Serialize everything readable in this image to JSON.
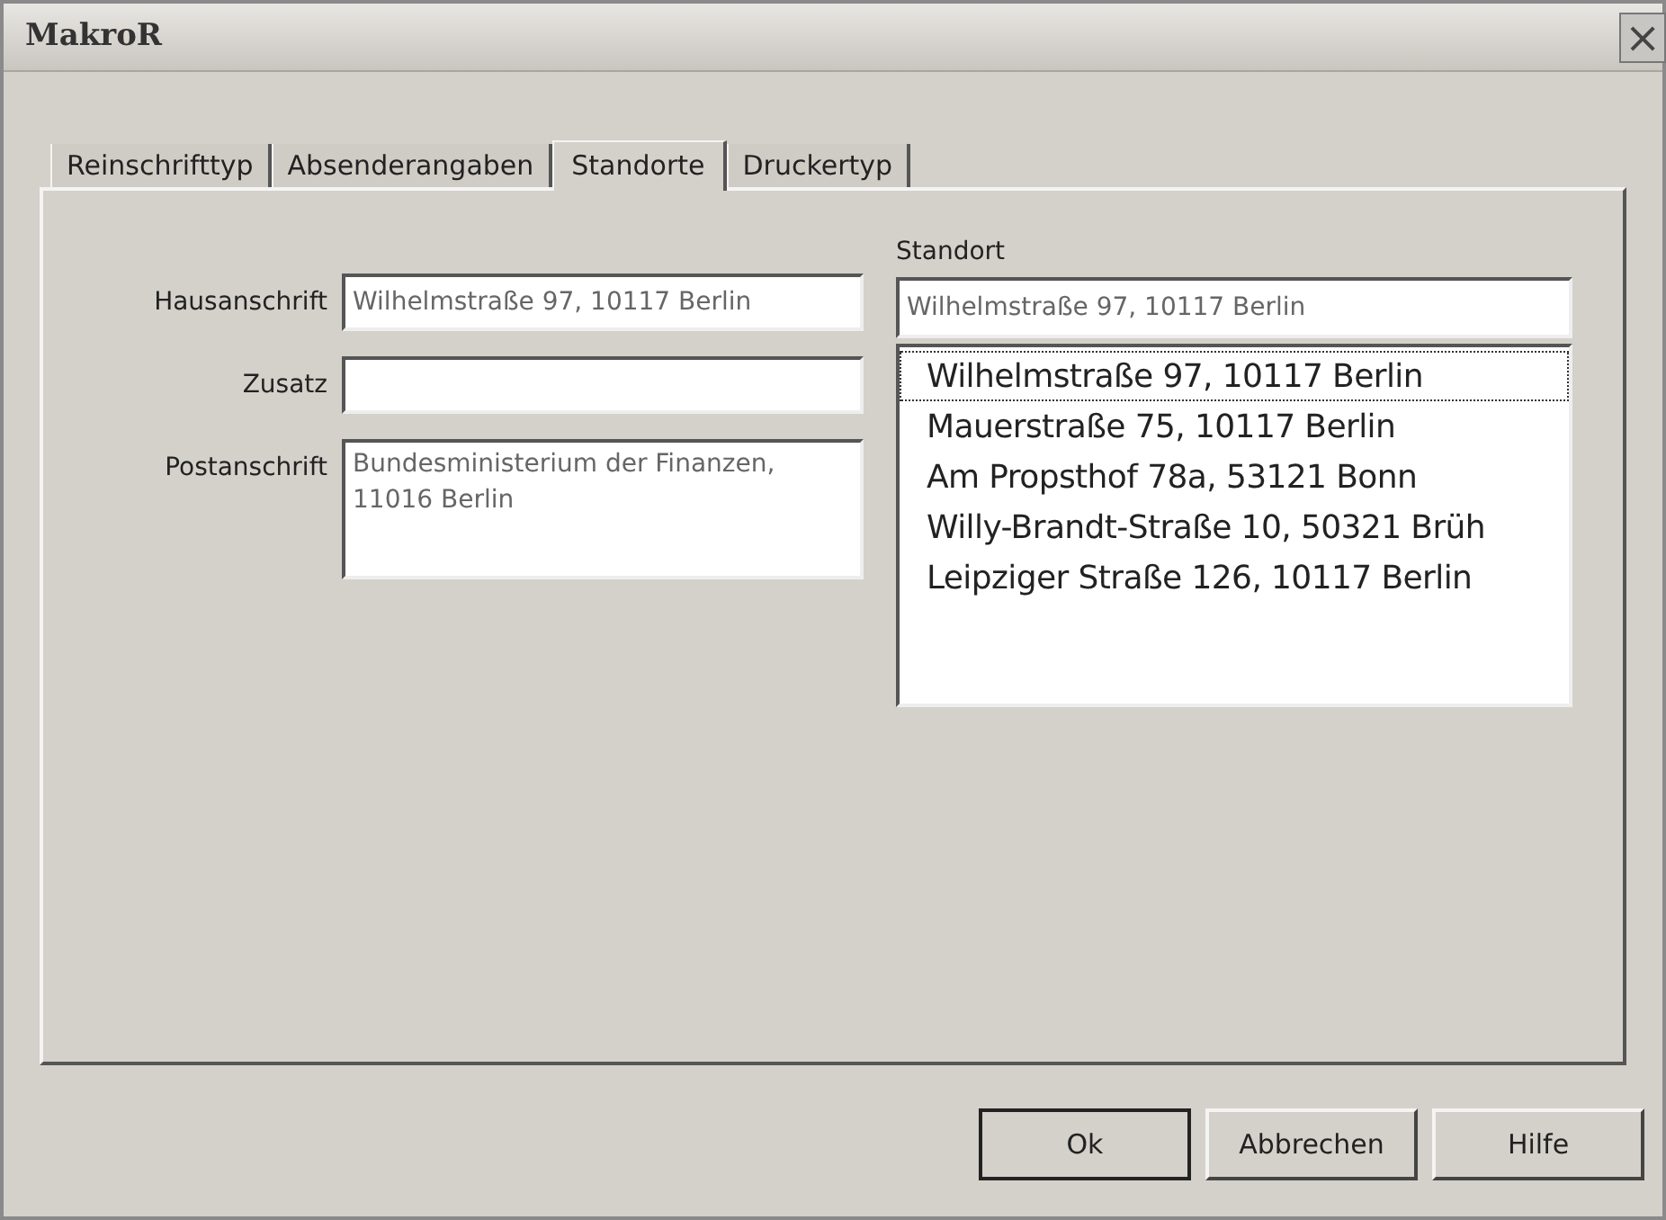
{
  "window": {
    "title": "MakroR",
    "close": "×"
  },
  "tabs": [
    {
      "label": "Reinschrifttyp",
      "selected": false
    },
    {
      "label": "Absenderangaben",
      "selected": false
    },
    {
      "label": "Standorte",
      "selected": true
    },
    {
      "label": "Druckertyp",
      "selected": false
    }
  ],
  "fields": [
    {
      "label": "Hausanschrift",
      "value": "Wilhelmstraße 97, 10117 Berlin",
      "kind": "line"
    },
    {
      "label": "Zusatz",
      "kind": "line"
    },
    {
      "label": "Postanschrift",
      "value": "Bundesministerium der Finanzen,\n11016 Berlin",
      "kind": "area"
    }
  ],
  "standort": {
    "label": "Standort",
    "value": "Wilhelmstraße 97, 10117 Berlin",
    "items": [
      {
        "text": "Wilhelmstraße 97, 10117 Berlin",
        "selected": true
      },
      {
        "text": "Mauerstraße 75, 10117 Berlin",
        "selected": false
      },
      {
        "text": "Am Propsthof 78a, 53121 Bonn",
        "selected": false
      },
      {
        "text": "Willy-Brandt-Straße 10, 50321 Brüh",
        "selected": false
      },
      {
        "text": "Leipziger Straße 126, 10117 Berlin",
        "selected": false
      }
    ]
  },
  "buttons": [
    {
      "label": "Ok",
      "default": true
    },
    {
      "label": "Abbrechen",
      "default": false
    },
    {
      "label": "Hilfe",
      "default": false
    }
  ]
}
